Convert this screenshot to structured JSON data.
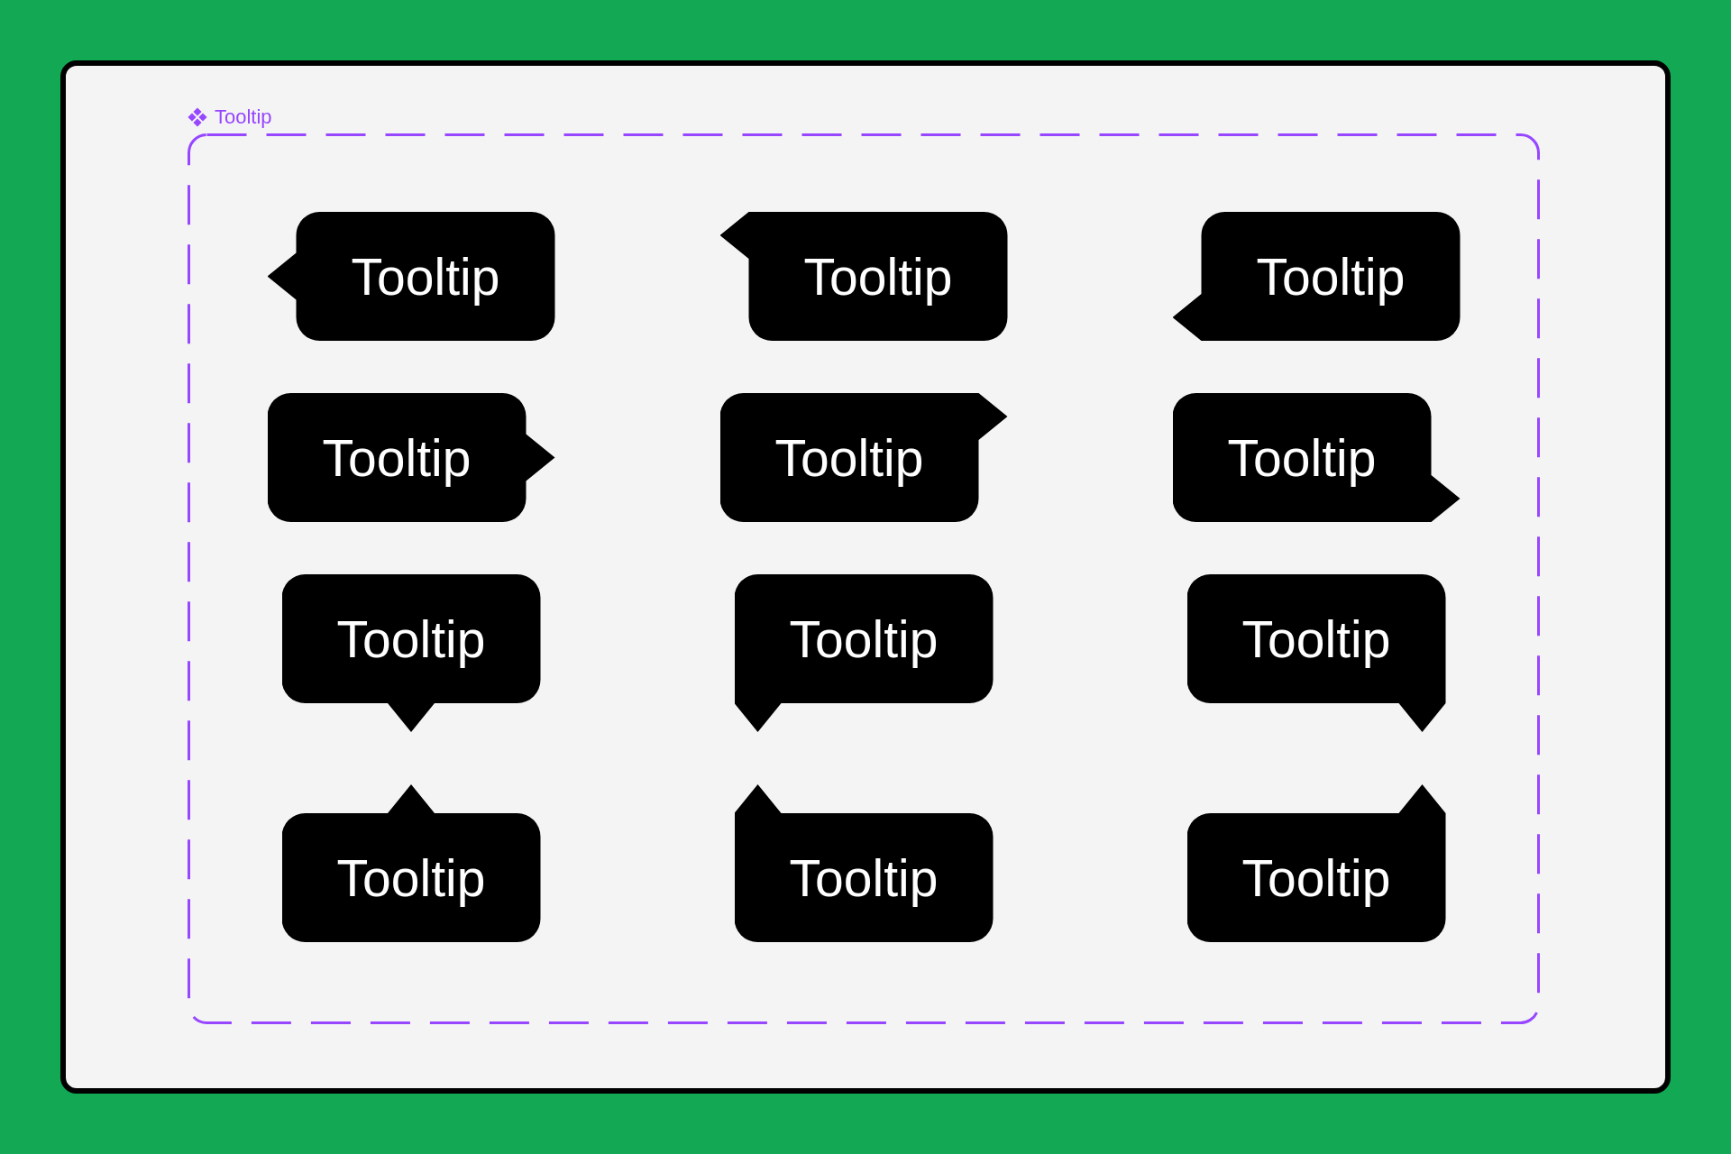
{
  "canvas": {
    "component_set": {
      "name": "Tooltip",
      "variants": [
        {
          "label": "Tooltip",
          "kind": "left-center"
        },
        {
          "label": "Tooltip",
          "kind": "left-start"
        },
        {
          "label": "Tooltip",
          "kind": "left-end"
        },
        {
          "label": "Tooltip",
          "kind": "right-center"
        },
        {
          "label": "Tooltip",
          "kind": "right-start"
        },
        {
          "label": "Tooltip",
          "kind": "right-end"
        },
        {
          "label": "Tooltip",
          "kind": "bottom-center"
        },
        {
          "label": "Tooltip",
          "kind": "bottom-start"
        },
        {
          "label": "Tooltip",
          "kind": "bottom-end"
        },
        {
          "label": "Tooltip",
          "kind": "top-center"
        },
        {
          "label": "Tooltip",
          "kind": "top-start"
        },
        {
          "label": "Tooltip",
          "kind": "top-end"
        }
      ]
    }
  }
}
